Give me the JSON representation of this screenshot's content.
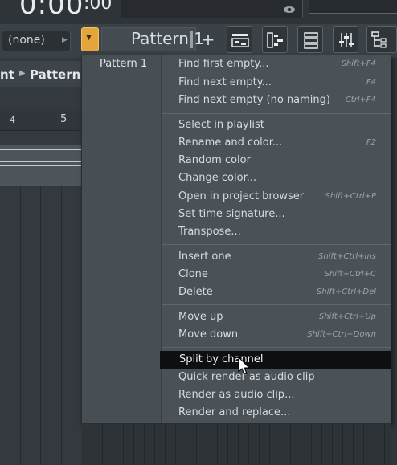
{
  "transport": {
    "time": "0:00",
    "time_fraction": ":00"
  },
  "toolbar": {
    "channel_select": "(none)",
    "pattern_name": "Pattern 1",
    "add_pattern": "+"
  },
  "breadcrumb": {
    "prefix": "nt",
    "current": "Pattern"
  },
  "ruler": {
    "bar4": "4",
    "bar5": "5"
  },
  "menu": {
    "pattern_list": [
      "Pattern 1"
    ],
    "items": [
      {
        "label": "Find first empty...",
        "shortcut": "Shift+F4"
      },
      {
        "label": "Find next empty...",
        "shortcut": "F4"
      },
      {
        "label": "Find next empty (no naming)",
        "shortcut": "Ctrl+F4"
      },
      {
        "label": "Select in playlist",
        "shortcut": ""
      },
      {
        "label": "Rename and color...",
        "shortcut": "F2"
      },
      {
        "label": "Random color",
        "shortcut": ""
      },
      {
        "label": "Change color...",
        "shortcut": ""
      },
      {
        "label": "Open in project browser",
        "shortcut": "Shift+Ctrl+P"
      },
      {
        "label": "Set time signature...",
        "shortcut": ""
      },
      {
        "label": "Transpose...",
        "shortcut": ""
      },
      {
        "label": "Insert one",
        "shortcut": "Shift+Ctrl+Ins"
      },
      {
        "label": "Clone",
        "shortcut": "Shift+Ctrl+C"
      },
      {
        "label": "Delete",
        "shortcut": "Shift+Ctrl+Del"
      },
      {
        "label": "Move up",
        "shortcut": "Shift+Ctrl+Up"
      },
      {
        "label": "Move down",
        "shortcut": "Shift+Ctrl+Down"
      },
      {
        "label": "Split by channel",
        "shortcut": ""
      },
      {
        "label": "Quick render as audio clip",
        "shortcut": ""
      },
      {
        "label": "Render as audio clip...",
        "shortcut": ""
      },
      {
        "label": "Render and replace...",
        "shortcut": ""
      }
    ],
    "selected_item": "Split by channel"
  },
  "colors": {
    "accent": "#e4a53b",
    "menu_bg": "#4b5257",
    "selected_bg": "#0d0f11",
    "panel_bg": "#3a4147"
  }
}
